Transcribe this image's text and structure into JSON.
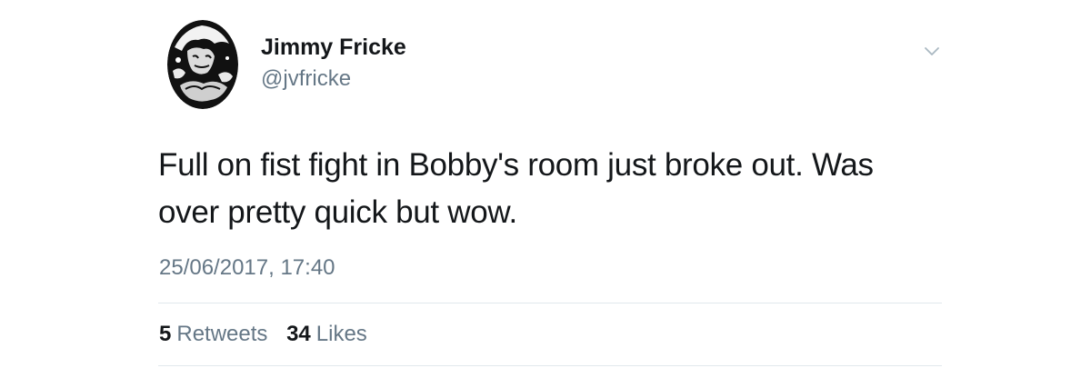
{
  "tweet": {
    "author": {
      "name": "Jimmy Fricke",
      "handle": "@jvfricke"
    },
    "text_lines": [
      "Full on fist fight in Bobby's room just broke out. Was",
      "over pretty quick but wow."
    ],
    "timestamp": "25/06/2017, 17:40",
    "stats": {
      "retweets_count": "5",
      "retweets_label": "Retweets",
      "likes_count": "34",
      "likes_label": "Likes"
    }
  },
  "icons": {
    "menu": "chevron-down-icon"
  },
  "colors": {
    "text_primary": "#14171a",
    "text_secondary": "#657786",
    "divider": "#e1e8ed",
    "background": "#ffffff"
  }
}
